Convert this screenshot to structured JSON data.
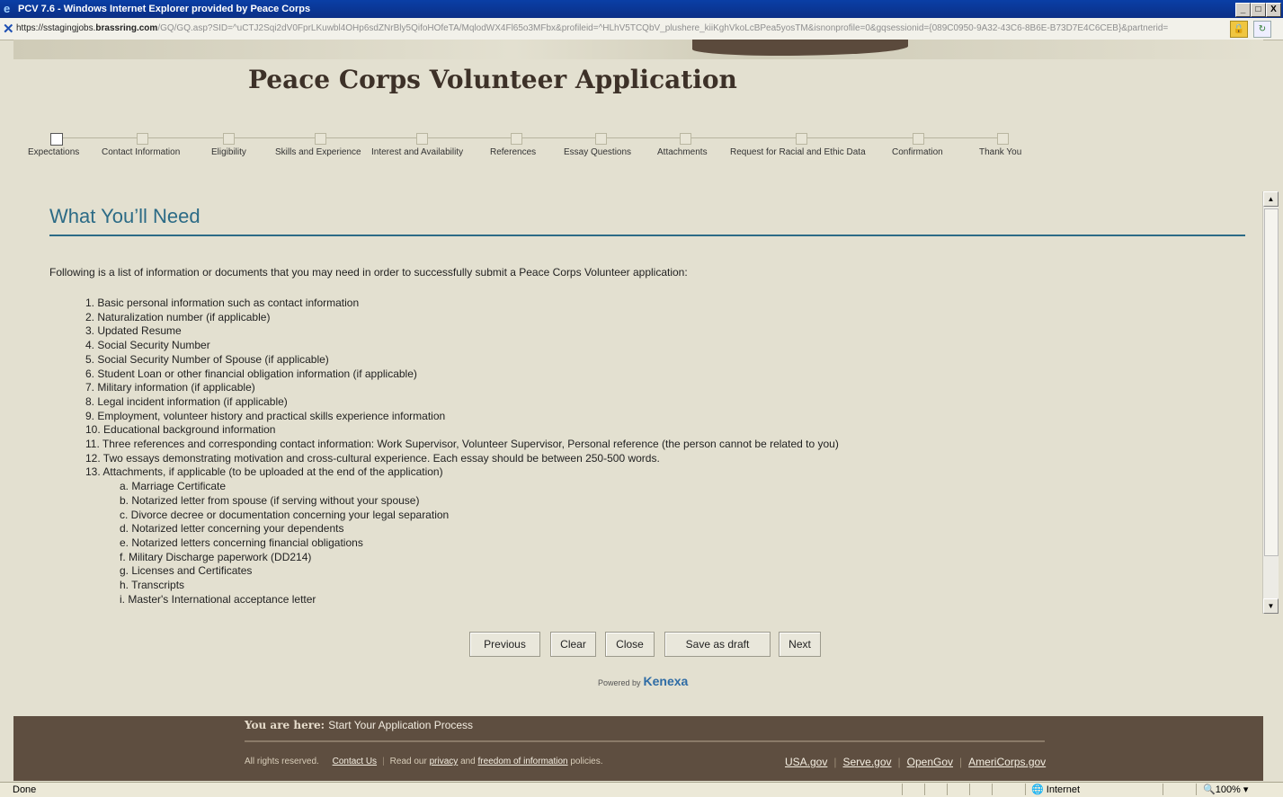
{
  "window": {
    "title": "PCV 7.6 - Windows Internet Explorer provided by Peace Corps",
    "min": "_",
    "max": "□",
    "close": "X"
  },
  "address": {
    "url_prefix": "https://sstagingjobs.",
    "url_domain": "brassring.com",
    "url_rest": "/GQ/GQ.asp?SID=^uCTJ2Sqi2dV0FprLKuwbl4OHp6sdZNrBly5QifoHOfeTA/MqlodWX4Fl65o3MFbx&profileid=^HLhV5TCQbV_plushere_kiiKghVkoLcBPea5yosTM&isnonprofile=0&gqsessionid={089C0950-9A32-43C6-8B6E-B73D7E4C6CEB}&partnerid="
  },
  "page": {
    "app_title": "Peace Corps Volunteer Application"
  },
  "steps": [
    {
      "label": "Expectations"
    },
    {
      "label": "Contact Information"
    },
    {
      "label": "Eligibility"
    },
    {
      "label": "Skills and Experience"
    },
    {
      "label": "Interest and Availability"
    },
    {
      "label": "References"
    },
    {
      "label": "Essay Questions"
    },
    {
      "label": "Attachments"
    },
    {
      "label": "Request for Racial and Ethic Data"
    },
    {
      "label": "Confirmation"
    },
    {
      "label": "Thank You"
    }
  ],
  "main": {
    "heading": "What You’ll Need",
    "intro": "Following is a list of information or documents that you may need in order to successfully submit a Peace Corps Volunteer application:",
    "items": [
      "1. Basic personal information such as contact information",
      "2. Naturalization number (if applicable)",
      "3. Updated Resume",
      "4. Social Security Number",
      "5. Social Security Number of Spouse (if applicable)",
      "6. Student Loan or other financial obligation information (if applicable)",
      "7. Military information (if applicable)",
      "8. Legal incident information (if applicable)",
      "9. Employment, volunteer history and practical skills experience information",
      "10. Educational background information",
      "11. Three references and corresponding contact information: Work Supervisor, Volunteer Supervisor, Personal reference (the person cannot be related to you)",
      "12. Two essays demonstrating motivation and cross-cultural experience. Each essay should be between 250-500 words.",
      "13. Attachments, if applicable (to be uploaded at the end of the application)"
    ],
    "subitems": [
      "a. Marriage Certificate",
      "b. Notarized letter from spouse (if serving without your spouse)",
      "c. Divorce decree or documentation concerning your legal separation",
      "d. Notarized letter concerning your dependents",
      "e. Notarized letters concerning financial obligations",
      "f. Military Discharge paperwork (DD214)",
      "g. Licenses and Certificates",
      "h. Transcripts",
      "i. Master's International acceptance letter"
    ]
  },
  "buttons": {
    "previous": "Previous",
    "clear": "Clear",
    "close": "Close",
    "save_draft": "Save as draft",
    "next": "Next"
  },
  "powered": {
    "text": "Powered by",
    "brand": "Kenexa"
  },
  "footer": {
    "you_are_here": "You are here:",
    "location": "Start Your Application Process",
    "rights": "All rights reserved.",
    "contact": "Contact Us",
    "read_our": "Read our",
    "privacy": "privacy",
    "and": "and",
    "foi": "freedom of information",
    "policies": "policies.",
    "links": [
      "USA.gov",
      "Serve.gov",
      "OpenGov",
      "AmeriCorps.gov"
    ]
  },
  "status": {
    "text": "Done",
    "zone": "Internet",
    "zoom": "100%"
  }
}
